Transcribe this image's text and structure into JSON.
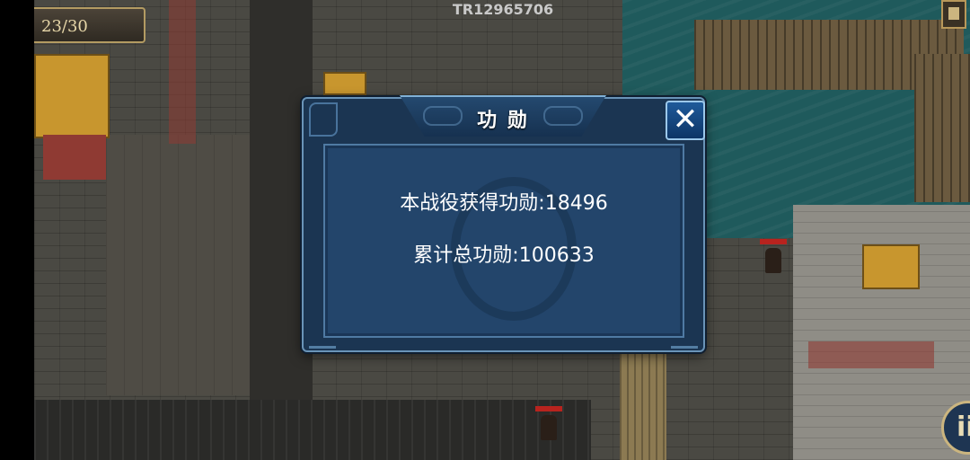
{
  "hud": {
    "counter": "23/30",
    "room_id": "TR12965706",
    "info_button_label": "ii"
  },
  "dialog": {
    "title": "功 勋",
    "close_label": "✕",
    "battle_merit_text": "本战役获得功勋:18496",
    "total_merit_text": "累计总功勋:100633"
  },
  "colors": {
    "dialog_bg": "#1b3552",
    "panel_bg": "#23456b",
    "close_button": "#1f5a9a",
    "counter_text": "#e6d6a8"
  }
}
